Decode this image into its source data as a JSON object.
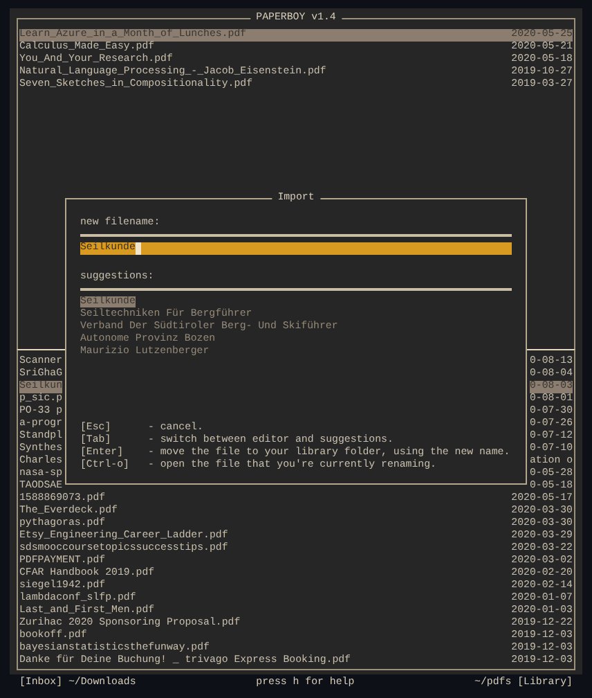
{
  "app_title": "PAPERBOY v1.4",
  "inbox": [
    {
      "name": "Learn_Azure_in_a_Month_of_Lunches.pdf",
      "date": "2020-05-25",
      "selected": true
    },
    {
      "name": "Calculus_Made_Easy.pdf",
      "date": "2020-05-21",
      "selected": false
    },
    {
      "name": "You_And_Your_Research.pdf",
      "date": "2020-05-18",
      "selected": false
    },
    {
      "name": "Natural_Language_Processing_-_Jacob_Eisenstein.pdf",
      "date": "2019-10-27",
      "selected": false
    },
    {
      "name": "Seven_Sketches_in_Compositionality.pdf",
      "date": "2019-03-27",
      "selected": false
    }
  ],
  "library": [
    {
      "name": "Scanner",
      "date": "0-08-13",
      "selected": false
    },
    {
      "name": "SriGhaG",
      "date": "0-08-04",
      "selected": false
    },
    {
      "name": "Seilkun",
      "date": "0-08-03",
      "selected": true
    },
    {
      "name": "p_sic.p",
      "date": "0-08-01",
      "selected": false
    },
    {
      "name": "PO-33 p",
      "date": "0-07-30",
      "selected": false
    },
    {
      "name": "a-progr",
      "date": "0-07-26",
      "selected": false
    },
    {
      "name": "Standpl",
      "date": "0-07-12",
      "selected": false
    },
    {
      "name": "Synthes",
      "date": "0-07-10",
      "selected": false
    },
    {
      "name": "Charles",
      "date": "ation o",
      "selected": false
    },
    {
      "name": "nasa-sp",
      "date": "0-05-28",
      "selected": false
    },
    {
      "name": "TAODSAE",
      "date": "0-05-18",
      "selected": false
    },
    {
      "name": "1588869073.pdf",
      "date": "2020-05-17",
      "selected": false
    },
    {
      "name": "The_Everdeck.pdf",
      "date": "2020-03-30",
      "selected": false
    },
    {
      "name": "pythagoras.pdf",
      "date": "2020-03-30",
      "selected": false
    },
    {
      "name": "Etsy_Engineering_Career_Ladder.pdf",
      "date": "2020-03-29",
      "selected": false
    },
    {
      "name": "sdsmooccoursetopicssuccesstips.pdf",
      "date": "2020-03-22",
      "selected": false
    },
    {
      "name": "PDFPAYMENT.pdf",
      "date": "2020-03-02",
      "selected": false
    },
    {
      "name": "CFAR Handbook 2019.pdf",
      "date": "2020-02-20",
      "selected": false
    },
    {
      "name": "siegel1942.pdf",
      "date": "2020-02-14",
      "selected": false
    },
    {
      "name": "lambdaconf_slfp.pdf",
      "date": "2020-01-07",
      "selected": false
    },
    {
      "name": "Last_and_First_Men.pdf",
      "date": "2020-01-03",
      "selected": false
    },
    {
      "name": "Zurihac 2020 Sponsoring Proposal.pdf",
      "date": "2019-12-22",
      "selected": false
    },
    {
      "name": "bookoff.pdf",
      "date": "2019-12-03",
      "selected": false
    },
    {
      "name": "bayesianstatisticsthefunway.pdf",
      "date": "2019-12-03",
      "selected": false
    },
    {
      "name": "Danke für Deine Buchung! _ trivago Express Booking.pdf",
      "date": "2019-12-03",
      "selected": false
    }
  ],
  "dialog": {
    "title": "Import",
    "filename_label": "new filename:",
    "filename_value": "Seilkunde",
    "suggestions_label": "suggestions:",
    "suggestions": [
      {
        "text": "Seilkunde",
        "selected": true
      },
      {
        "text": "Seiltechniken Für Bergführer",
        "selected": false
      },
      {
        "text": "Verband Der Südtiroler Berg- Und Skiführer",
        "selected": false
      },
      {
        "text": "Autonome Provinz Bozen",
        "selected": false
      },
      {
        "text": "Maurizio Lutzenberger",
        "selected": false
      }
    ],
    "help": [
      {
        "key": "[Esc]",
        "desc": "- cancel."
      },
      {
        "key": "[Tab]",
        "desc": "- switch between editor and suggestions."
      },
      {
        "key": "[Enter]",
        "desc": "- move the file to your library folder, using the new name."
      },
      {
        "key": "[Ctrl-o]",
        "desc": "- open the file that you're currently renaming."
      }
    ]
  },
  "status_bar": {
    "left": "[Inbox] ~/Downloads",
    "center": "press h for help",
    "right": "~/pdfs [Library]"
  }
}
